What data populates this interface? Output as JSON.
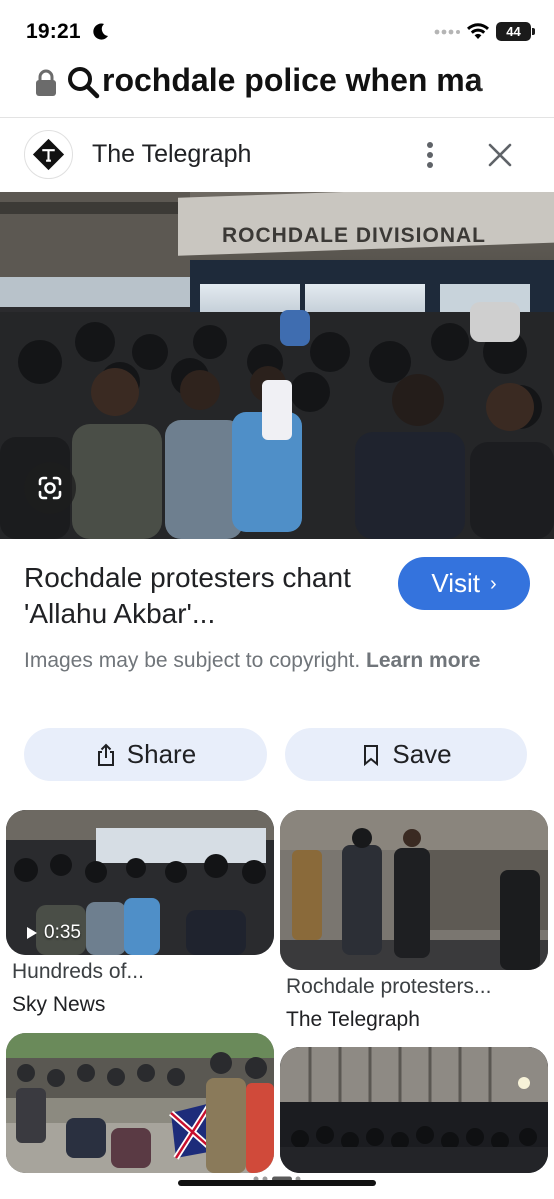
{
  "status": {
    "time": "19:21",
    "battery": "44"
  },
  "url_bar": {
    "text": "rochdale police when ma"
  },
  "source": {
    "name": "The Telegraph"
  },
  "main_image": {
    "building_sign": "ROCHDALE DIVISIONAL"
  },
  "result": {
    "title": "Rochdale protesters chant 'Allahu Akbar'...",
    "visit_label": "Visit",
    "copyright_text": "Images may be subject to copyright.",
    "learn_more": "Learn more"
  },
  "actions": {
    "share_label": "Share",
    "save_label": "Save"
  },
  "related": [
    {
      "title": "Hundreds of...",
      "source": "Sky News",
      "duration": "0:35"
    },
    {
      "title": "Rochdale protesters...",
      "source": "The Telegraph"
    },
    {
      "title": "",
      "source": ""
    },
    {
      "title": "",
      "source": ""
    }
  ],
  "colors": {
    "visit_button": "#3473dd",
    "action_button_bg": "#e8eefa",
    "secondary_text": "#70757a"
  },
  "icons": [
    "moon-icon",
    "wifi-icon",
    "lock-icon",
    "search-icon",
    "telegraph-logo",
    "more-vert-icon",
    "close-icon",
    "lens-icon",
    "chevron-right-icon",
    "share-icon",
    "bookmark-icon",
    "play-icon"
  ]
}
